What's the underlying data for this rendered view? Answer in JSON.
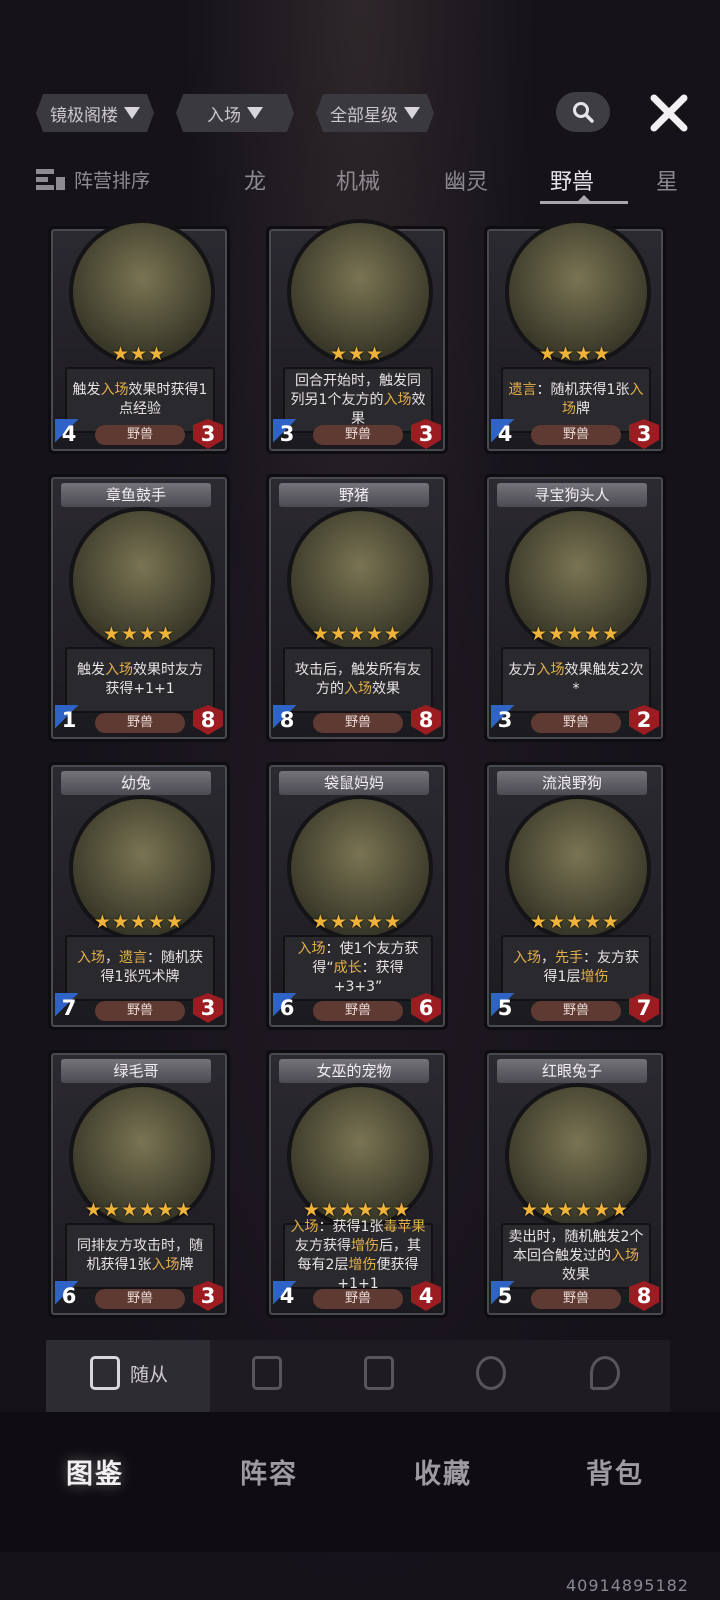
{
  "filters": [
    {
      "label": "镜极阁楼"
    },
    {
      "label": "入场"
    },
    {
      "label": "全部星级"
    }
  ],
  "icons": {
    "search": "search-icon",
    "close": "close-icon"
  },
  "sort_label": "阵营排序",
  "tabs": [
    "龙",
    "机械",
    "幽灵",
    "野兽",
    "星"
  ],
  "active_tab": "野兽",
  "cards": [
    {
      "name": "",
      "stars": "★★★",
      "desc": [
        "触发",
        "入场",
        "效果时",
        "获得1点经验"
      ],
      "type": "野兽",
      "atk": "4",
      "hp": "3"
    },
    {
      "name": "",
      "stars": "★★★",
      "desc": [
        "回合开始时，触发",
        "同列另1个友方的",
        "入场",
        "效果"
      ],
      "type": "野兽",
      "atk": "3",
      "hp": "3"
    },
    {
      "name": "",
      "stars": "★★★★",
      "desc": [
        "遗言",
        "：随机获得1张",
        "入场",
        "牌"
      ],
      "type": "野兽",
      "atk": "4",
      "hp": "3"
    },
    {
      "name": "章鱼鼓手",
      "stars": "★★★★",
      "desc": [
        "触发",
        "入场",
        "效果时",
        "友方获得+1+1"
      ],
      "type": "野兽",
      "atk": "1",
      "hp": "8"
    },
    {
      "name": "野猪",
      "stars": "★★★★★",
      "desc": [
        "攻击后，触发所有友",
        "方的",
        "入场",
        "效果"
      ],
      "type": "野兽",
      "atk": "8",
      "hp": "8"
    },
    {
      "name": "寻宝狗头人",
      "stars": "★★★★★",
      "desc": [
        "友方",
        "入场",
        "效果",
        "触发2次*"
      ],
      "type": "野兽",
      "atk": "3",
      "hp": "2"
    },
    {
      "name": "幼兔",
      "stars": "★★★★★",
      "desc": [
        "入场",
        "，",
        "遗言",
        "：随机",
        "获得1张咒术牌"
      ],
      "type": "野兽",
      "atk": "7",
      "hp": "3"
    },
    {
      "name": "袋鼠妈妈",
      "stars": "★★★★★",
      "desc": [
        "入场",
        "：使1个友方",
        "获得“",
        "成长",
        "：获得",
        "+3+3”"
      ],
      "type": "野兽",
      "atk": "6",
      "hp": "6"
    },
    {
      "name": "流浪野狗",
      "stars": "★★★★★",
      "desc": [
        "入场",
        "，",
        "先手",
        "：友方",
        "获得1层",
        "增伤"
      ],
      "type": "野兽",
      "atk": "5",
      "hp": "7"
    },
    {
      "name": "绿毛哥",
      "stars": "★★★★★★",
      "desc": [
        "同排友方攻击时，随",
        "机获得1张",
        "入场",
        "牌"
      ],
      "type": "野兽",
      "atk": "6",
      "hp": "3"
    },
    {
      "name": "女巫的宠物",
      "stars": "★★★★★★",
      "desc": [
        "入场",
        "：获得1张",
        "毒苹果",
        "友方获得",
        "增伤",
        "后，其每",
        "有2层",
        "增伤",
        "便获得+1+1"
      ],
      "type": "野兽",
      "atk": "4",
      "hp": "4"
    },
    {
      "name": "红眼兔子",
      "stars": "★★★★★★",
      "desc": [
        "卖出时，随机触发2个",
        "本回合触发过的",
        "入场",
        "效果"
      ],
      "type": "野兽",
      "atk": "5",
      "hp": "8"
    }
  ],
  "categories": [
    {
      "label": "随从",
      "icon": "minion-card-icon"
    },
    {
      "label": "",
      "icon": "spell-card-icon"
    },
    {
      "label": "",
      "icon": "item-card-icon"
    },
    {
      "label": "",
      "icon": "hero-icon"
    },
    {
      "label": "",
      "icon": "skill-icon"
    }
  ],
  "nav": [
    "图鉴",
    "阵容",
    "收藏",
    "背包"
  ],
  "watermark": "40914895182",
  "colors": {
    "keyword": "#e3b04a",
    "star": "#f0b33a",
    "attack": "#2f64c6",
    "health": "#9b1d22"
  }
}
